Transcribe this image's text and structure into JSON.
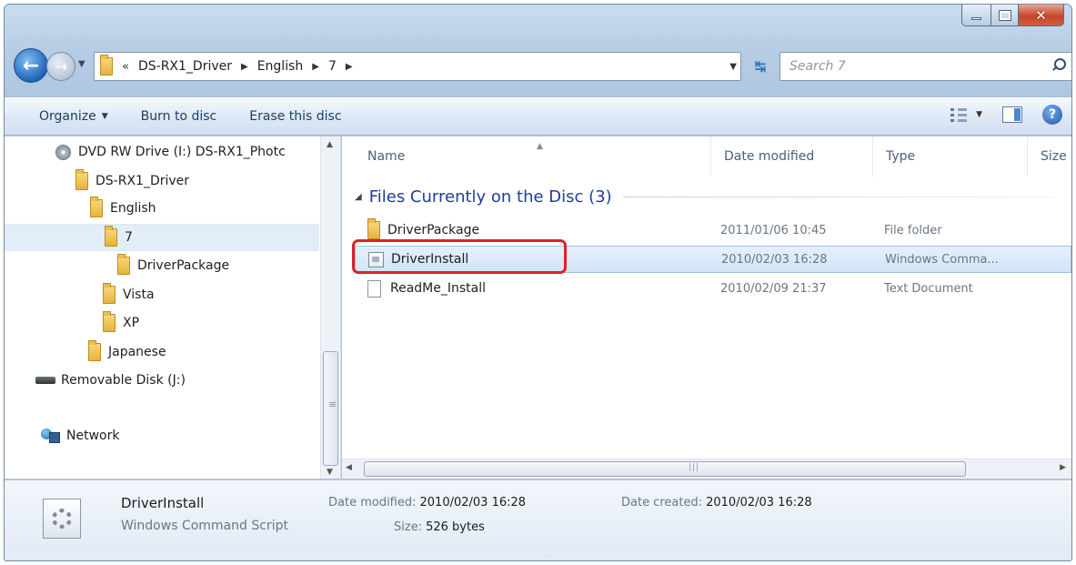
{
  "address": {
    "overflow": "«",
    "crumbs": [
      "DS-RX1_Driver",
      "English",
      "7"
    ],
    "search_placeholder": "Search 7"
  },
  "toolbar": {
    "organize": "Organize",
    "burn": "Burn to disc",
    "erase": "Erase this disc"
  },
  "nav": {
    "items": [
      {
        "label": "DVD RW Drive (I:) DS-RX1_Photc",
        "icon": "dvd-drive-icon"
      },
      {
        "label": "DS-RX1_Driver",
        "icon": "folder-icon"
      },
      {
        "label": "English",
        "icon": "folder-icon"
      },
      {
        "label": "7",
        "icon": "folder-icon",
        "selected": true
      },
      {
        "label": "DriverPackage",
        "icon": "folder-icon"
      },
      {
        "label": "Vista",
        "icon": "folder-icon"
      },
      {
        "label": "XP",
        "icon": "folder-icon"
      },
      {
        "label": "Japanese",
        "icon": "folder-icon"
      },
      {
        "label": "Removable Disk (J:)",
        "icon": "removable-disk-icon"
      },
      {
        "label": "Network",
        "icon": "network-icon"
      }
    ]
  },
  "columns": {
    "name": "Name",
    "date": "Date modified",
    "type": "Type",
    "size": "Size"
  },
  "group": {
    "title": "Files Currently on the Disc (3)"
  },
  "files": [
    {
      "name": "DriverPackage",
      "date": "2011/01/06 10:45",
      "type": "File folder",
      "icon": "folder-icon"
    },
    {
      "name": "DriverInstall",
      "date": "2010/02/03 16:28",
      "type": "Windows Comma...",
      "icon": "script-icon",
      "selected": true
    },
    {
      "name": "ReadMe_Install",
      "date": "2010/02/09 21:37",
      "type": "Text Document",
      "icon": "text-document-icon"
    }
  ],
  "details": {
    "name": "DriverInstall",
    "type": "Windows Command Script",
    "modified_label": "Date modified:",
    "modified_value": "2010/02/03 16:28",
    "size_label": "Size:",
    "size_value": "526 bytes",
    "created_label": "Date created:",
    "created_value": "2010/02/03 16:28"
  },
  "colors": {
    "selection": "#d3e4f7",
    "highlight_box": "#d9222a",
    "group_header": "#1e3e9a"
  }
}
